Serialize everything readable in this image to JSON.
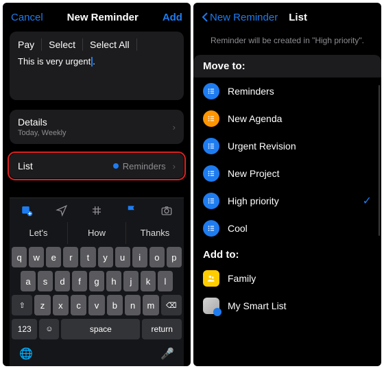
{
  "left": {
    "nav": {
      "cancel": "Cancel",
      "title": "New Reminder",
      "add": "Add"
    },
    "title_input": "Pay",
    "menu": {
      "select": "Select",
      "select_all": "Select All"
    },
    "notes": "This is very urgent",
    "details": {
      "label": "Details",
      "value": "Today, Weekly"
    },
    "list_row": {
      "label": "List",
      "value": "Reminders"
    },
    "suggestions": [
      "Let's",
      "How",
      "Thanks"
    ],
    "keyboard": {
      "rows": [
        [
          "q",
          "w",
          "e",
          "r",
          "t",
          "y",
          "u",
          "i",
          "o",
          "p"
        ],
        [
          "a",
          "s",
          "d",
          "f",
          "g",
          "h",
          "j",
          "k",
          "l"
        ],
        [
          "z",
          "x",
          "c",
          "v",
          "b",
          "n",
          "m"
        ]
      ],
      "num": "123",
      "space": "space",
      "return": "return"
    }
  },
  "right": {
    "nav": {
      "back": "New Reminder",
      "title": "List"
    },
    "sub": "Reminder will be created in \"High priority\".",
    "move_header": "Move to:",
    "move": [
      {
        "name": "Reminders",
        "color": "b-blue",
        "selected": false
      },
      {
        "name": "New Agenda",
        "color": "b-orange",
        "selected": false
      },
      {
        "name": "Urgent Revision",
        "color": "b-blue",
        "selected": false
      },
      {
        "name": "New Project",
        "color": "b-blue",
        "selected": false
      },
      {
        "name": "High priority",
        "color": "b-blue",
        "selected": true
      },
      {
        "name": "Cool",
        "color": "b-blue",
        "selected": false
      }
    ],
    "add_header": "Add to:",
    "add": [
      {
        "name": "Family",
        "icon": "family"
      },
      {
        "name": "My Smart List",
        "icon": "smart"
      }
    ]
  }
}
